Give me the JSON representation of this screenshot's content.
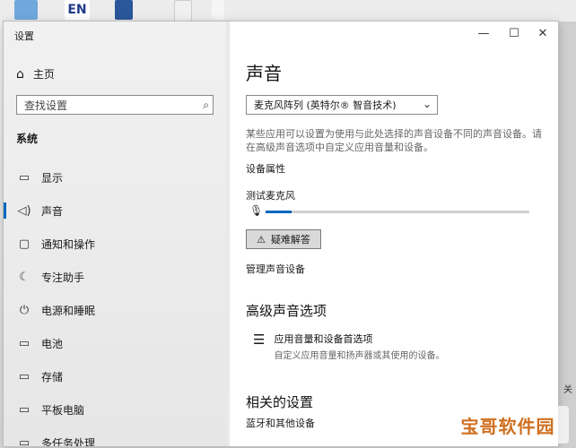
{
  "window": {
    "title": "设置",
    "controls": {
      "minimize": "—",
      "maximize": "☐",
      "close": "✕"
    }
  },
  "sidebar": {
    "home": "主页",
    "search_placeholder": "查找设置",
    "section": "系统",
    "items": [
      {
        "label": "显示",
        "icon": "monitor-icon",
        "glyph": "▭"
      },
      {
        "label": "声音",
        "icon": "speaker-icon",
        "glyph": "🕪"
      },
      {
        "label": "通知和操作",
        "icon": "notification-icon",
        "glyph": "▢"
      },
      {
        "label": "专注助手",
        "icon": "moon-icon",
        "glyph": "☾"
      },
      {
        "label": "电源和睡眠",
        "icon": "power-icon",
        "glyph": "⏻"
      },
      {
        "label": "电池",
        "icon": "battery-icon",
        "glyph": "▭"
      },
      {
        "label": "存储",
        "icon": "storage-icon",
        "glyph": "▭"
      },
      {
        "label": "平板电脑",
        "icon": "tablet-icon",
        "glyph": "▭"
      },
      {
        "label": "多任务处理",
        "icon": "multitask-icon",
        "glyph": "▭"
      }
    ],
    "active_index": 1
  },
  "main": {
    "title": "声音",
    "input_device": "麦克风阵列 (英特尔® 智音技术)",
    "description": "某些应用可以设置为使用与此处选择的声音设备不同的声音设备。请在高级声音选项中自定义应用音量和设备。",
    "device_properties": "设备属性",
    "test_mic": "测试麦克风",
    "mic_level": 0.1,
    "troubleshoot": "疑难解答",
    "manage_devices": "管理声音设备",
    "advanced_title": "高级声音选项",
    "advanced_item_title": "应用音量和设备首选项",
    "advanced_item_desc": "自定义应用音量和扬声器或其使用的设备。",
    "related_title": "相关的设置",
    "bluetooth": "蓝牙和其他设备"
  },
  "desktop": {
    "en_label": "EN",
    "right_text": "关"
  },
  "watermark": "宝哥软件园",
  "colors": {
    "accent": "#0067c0"
  }
}
